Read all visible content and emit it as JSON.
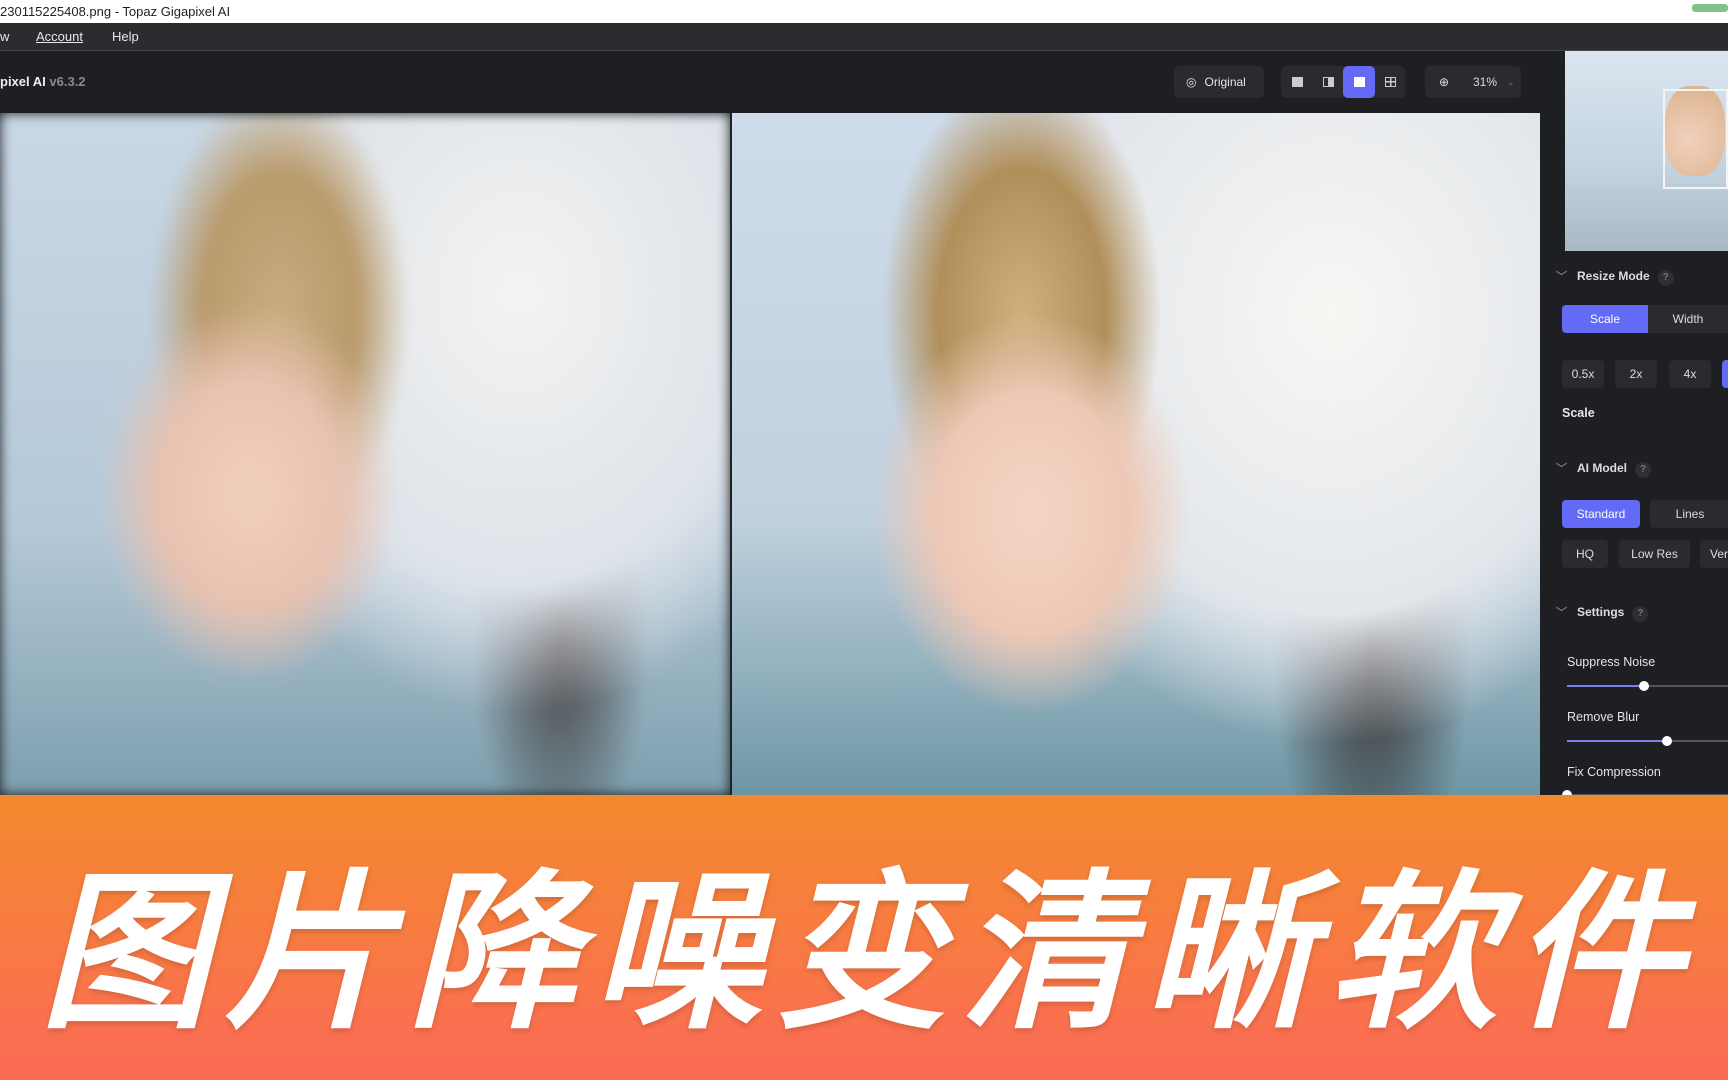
{
  "window": {
    "title": "230115225408.png - Topaz Gigapixel AI"
  },
  "menu": {
    "items": [
      "w",
      "Account",
      "Help"
    ]
  },
  "header": {
    "app_name": "pixel AI",
    "version": "v6.3.2",
    "original_label": "Original",
    "zoom_label": "31%",
    "view_modes": [
      {
        "name": "single",
        "active": false
      },
      {
        "name": "split",
        "active": false
      },
      {
        "name": "side-by-side",
        "active": true
      },
      {
        "name": "grid",
        "active": false
      }
    ]
  },
  "sidebar": {
    "resize_mode": {
      "title": "Resize Mode",
      "help": "?",
      "tabs": [
        {
          "label": "Scale",
          "active": true
        },
        {
          "label": "Width",
          "active": false
        }
      ],
      "scales": [
        "0.5x",
        "2x",
        "4x"
      ],
      "scale_label": "Scale"
    },
    "ai_model": {
      "title": "AI Model",
      "help": "?",
      "models": [
        {
          "label": "Standard",
          "active": true
        },
        {
          "label": "Lines",
          "active": false
        },
        {
          "label": "HQ",
          "active": false
        },
        {
          "label": "Low Res",
          "active": false
        },
        {
          "label": "Ver",
          "active": false
        }
      ]
    },
    "settings": {
      "title": "Settings",
      "help": "?",
      "sliders": [
        {
          "label": "Suppress Noise",
          "value": 0.48
        },
        {
          "label": "Remove Blur",
          "value": 0.62
        },
        {
          "label": "Fix Compression",
          "value": 0.0
        }
      ]
    }
  },
  "banner": {
    "text": "图片降噪变清晰软件"
  },
  "colors": {
    "accent": "#636af5",
    "banner_top": "#f2892e",
    "banner_bottom": "#fb6a57"
  }
}
